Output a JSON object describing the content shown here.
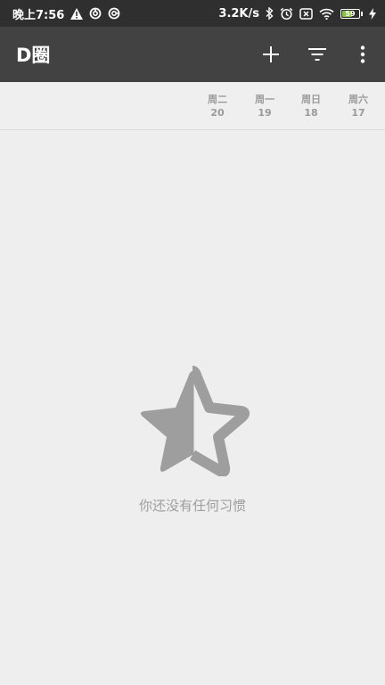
{
  "status_bar": {
    "time": "晚上7:56",
    "net_speed": "3.2K/s",
    "battery_level": "59",
    "icons": [
      "warning-icon",
      "sync-icon",
      "sync-icon",
      "bluetooth-icon",
      "alarm-icon",
      "sim-blocked-icon",
      "wifi-icon",
      "battery-icon",
      "charging-icon"
    ]
  },
  "toolbar": {
    "title": "D圈",
    "actions": [
      "add-icon",
      "filter-icon",
      "more-vert-icon"
    ]
  },
  "days": [
    {
      "weekday": "周二",
      "date": "20"
    },
    {
      "weekday": "周一",
      "date": "19"
    },
    {
      "weekday": "周日",
      "date": "18"
    },
    {
      "weekday": "周六",
      "date": "17"
    }
  ],
  "empty_state": {
    "icon": "star-half-icon",
    "message": "你还没有任何习惯"
  },
  "colors": {
    "status_bar": "#2f2f2f",
    "toolbar": "#424242",
    "background": "#eeeeee",
    "muted_text": "#9e9e9e",
    "battery_fill": "#8bc34a"
  }
}
